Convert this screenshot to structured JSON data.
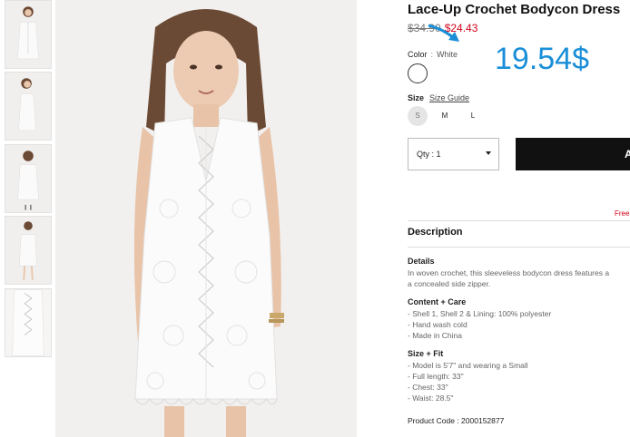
{
  "product": {
    "title": "Lace-Up Crochet Bodycon Dress",
    "price_original": "$34.90",
    "price_sale": "$24.43"
  },
  "annotation": {
    "price_text": "19.54$",
    "color": "#1a8fd8"
  },
  "color_option": {
    "label": "Color",
    "separator": ":",
    "value": "White"
  },
  "size": {
    "label": "Size",
    "guide_link": "Size Guide",
    "options": [
      "S",
      "M",
      "L"
    ],
    "selected": "S"
  },
  "quantity": {
    "display": "Qty : 1"
  },
  "add_button": {
    "label": "A"
  },
  "free_shipping": "Free",
  "description": {
    "heading": "Description",
    "details_title": "Details",
    "details_lines": [
      "In woven crochet, this sleeveless bodycon dress features a",
      "a concealed side zipper."
    ],
    "content_title": "Content + Care",
    "content_lines": [
      "- Shell 1, Shell 2 & Lining: 100% polyester",
      "- Hand wash cold",
      "- Made in China"
    ],
    "fit_title": "Size + Fit",
    "fit_lines": [
      "- Model is 5'7\" and wearing a Small",
      "- Full length: 33\"",
      "- Chest: 33\"",
      "- Waist: 28.5\""
    ],
    "product_code": "Product Code : 2000152877"
  },
  "colors": {
    "sale_red": "#d0021b",
    "button_black": "#111111",
    "annotation_blue": "#1a8fd8"
  }
}
